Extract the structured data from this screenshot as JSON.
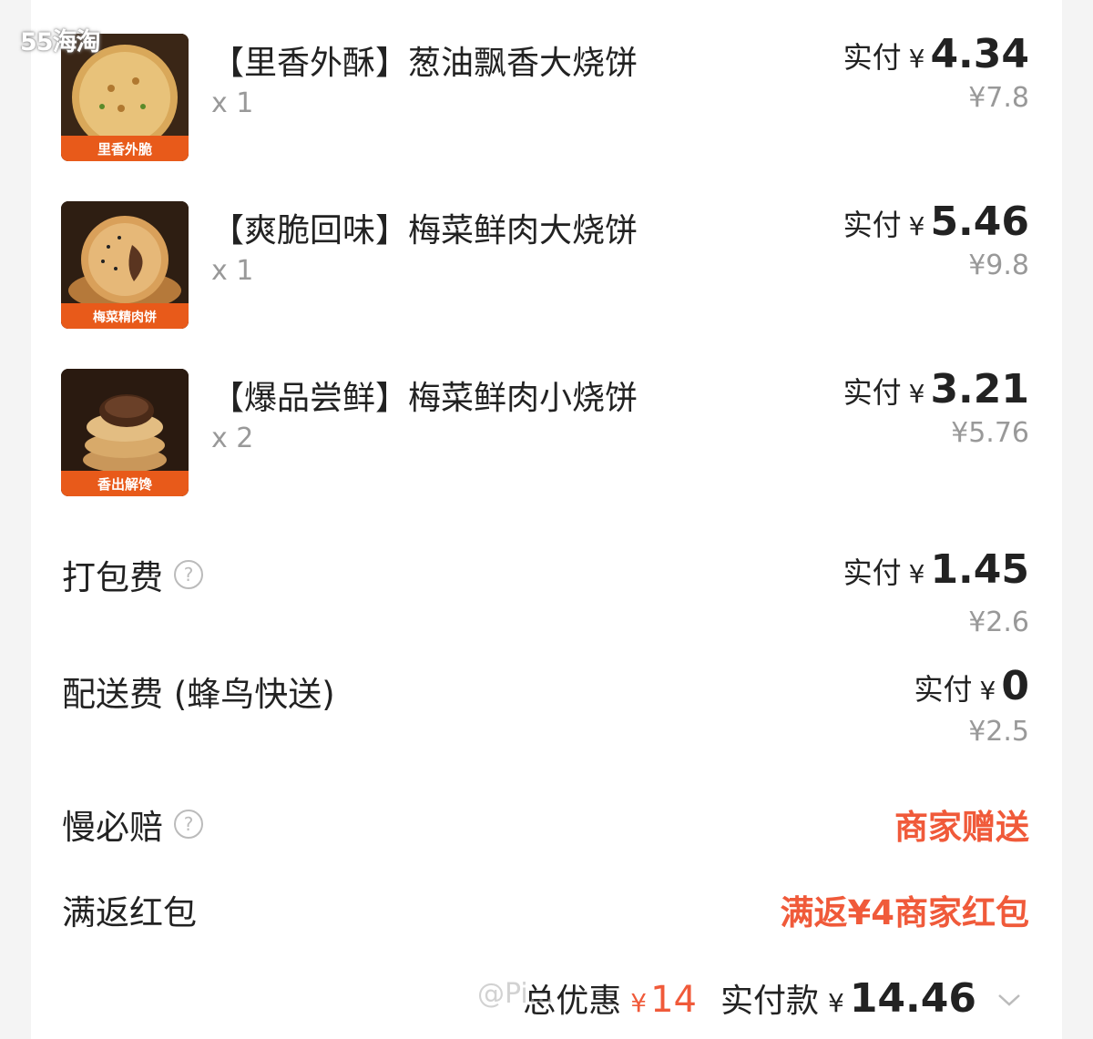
{
  "watermark_top": "55海淘",
  "watermark_bottom": "@Pi...",
  "items": [
    {
      "title": "【里香外酥】葱油飘香大烧饼",
      "qty": "x 1",
      "paid_label": "实付",
      "currency": "¥",
      "paid": "4.34",
      "original": "¥7.8",
      "image_caption": "里香外脆",
      "image_icon": "flatbread-icon"
    },
    {
      "title": "【爽脆回味】梅菜鲜肉大烧饼",
      "qty": "x 1",
      "paid_label": "实付",
      "currency": "¥",
      "paid": "5.46",
      "original": "¥9.8",
      "image_caption": "梅菜精肉饼",
      "image_icon": "sesame-flatbread-icon"
    },
    {
      "title": "【爆品尝鲜】梅菜鲜肉小烧饼",
      "qty": "x 2",
      "paid_label": "实付",
      "currency": "¥",
      "paid": "3.21",
      "original": "¥5.76",
      "image_caption": "香出解馋",
      "image_icon": "stacked-buns-icon"
    }
  ],
  "packing_fee": {
    "label": "打包费",
    "help_icon": "question-circle-icon",
    "paid_label": "实付",
    "currency": "¥",
    "paid": "1.45",
    "original": "¥2.6"
  },
  "delivery_fee": {
    "label": "配送费 (蜂鸟快送)",
    "paid_label": "实付",
    "currency": "¥",
    "paid": "0",
    "original": "¥2.5"
  },
  "slow_compensation": {
    "label": "慢必赔",
    "help_icon": "question-circle-icon",
    "value": "商家赠送"
  },
  "cashback": {
    "label": "满返红包",
    "value": "满返¥4商家红包"
  },
  "total": {
    "discount_label": "总优惠",
    "discount_currency": "¥",
    "discount": "14",
    "pay_label": "实付款",
    "pay_currency": "¥",
    "pay": "14.46",
    "expand_icon": "chevron-down-icon"
  },
  "colors": {
    "accent_red": "#f05a3a",
    "muted_gray": "#999999",
    "text": "#222222"
  }
}
